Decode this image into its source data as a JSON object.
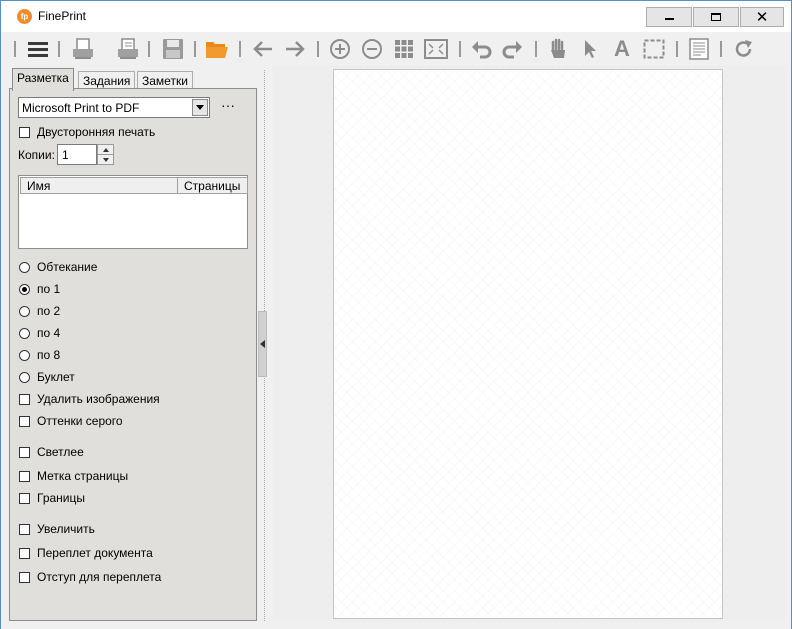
{
  "window": {
    "title": "FinePrint",
    "app_icon_text": "fp"
  },
  "toolbar": {
    "icons": [
      "menu-icon",
      "print-icon",
      "print-save-icon",
      "save-icon",
      "open-folder-icon",
      "back-arrow-icon",
      "forward-arrow-icon",
      "zoom-in-icon",
      "zoom-out-icon",
      "grid-view-icon",
      "fit-page-icon",
      "undo-icon",
      "redo-icon",
      "hand-tool-icon",
      "pointer-tool-icon",
      "text-tool-icon",
      "select-area-icon",
      "page-icon",
      "refresh-icon"
    ]
  },
  "tabs": [
    "Разметка",
    "Задания",
    "Заметки"
  ],
  "layout_tab": {
    "printer": "Microsoft Print to PDF",
    "ellipsis": "···",
    "duplex_label": "Двусторонняя печать",
    "copies_label": "Копии:",
    "copies_value": "1",
    "columns": [
      "Имя",
      "Страницы"
    ],
    "radios": [
      {
        "label": "Обтекание",
        "checked": false
      },
      {
        "label": "по 1",
        "checked": true
      },
      {
        "label": "по 2",
        "checked": false
      },
      {
        "label": "по 4",
        "checked": false
      },
      {
        "label": "по 8",
        "checked": false
      },
      {
        "label": "Буклет",
        "checked": false
      }
    ],
    "checkboxes": [
      "Удалить изображения",
      "Оттенки серого",
      "Светлее",
      "Метка страницы",
      "Границы",
      "Увеличить",
      "Переплет документа",
      "Отступ для переплета"
    ]
  },
  "colors": {
    "accent_orange": "#f28c28",
    "panel_bg": "#e1dfdb",
    "icon_gray": "#8c8c8c",
    "folder_orange": "#e8891c"
  }
}
